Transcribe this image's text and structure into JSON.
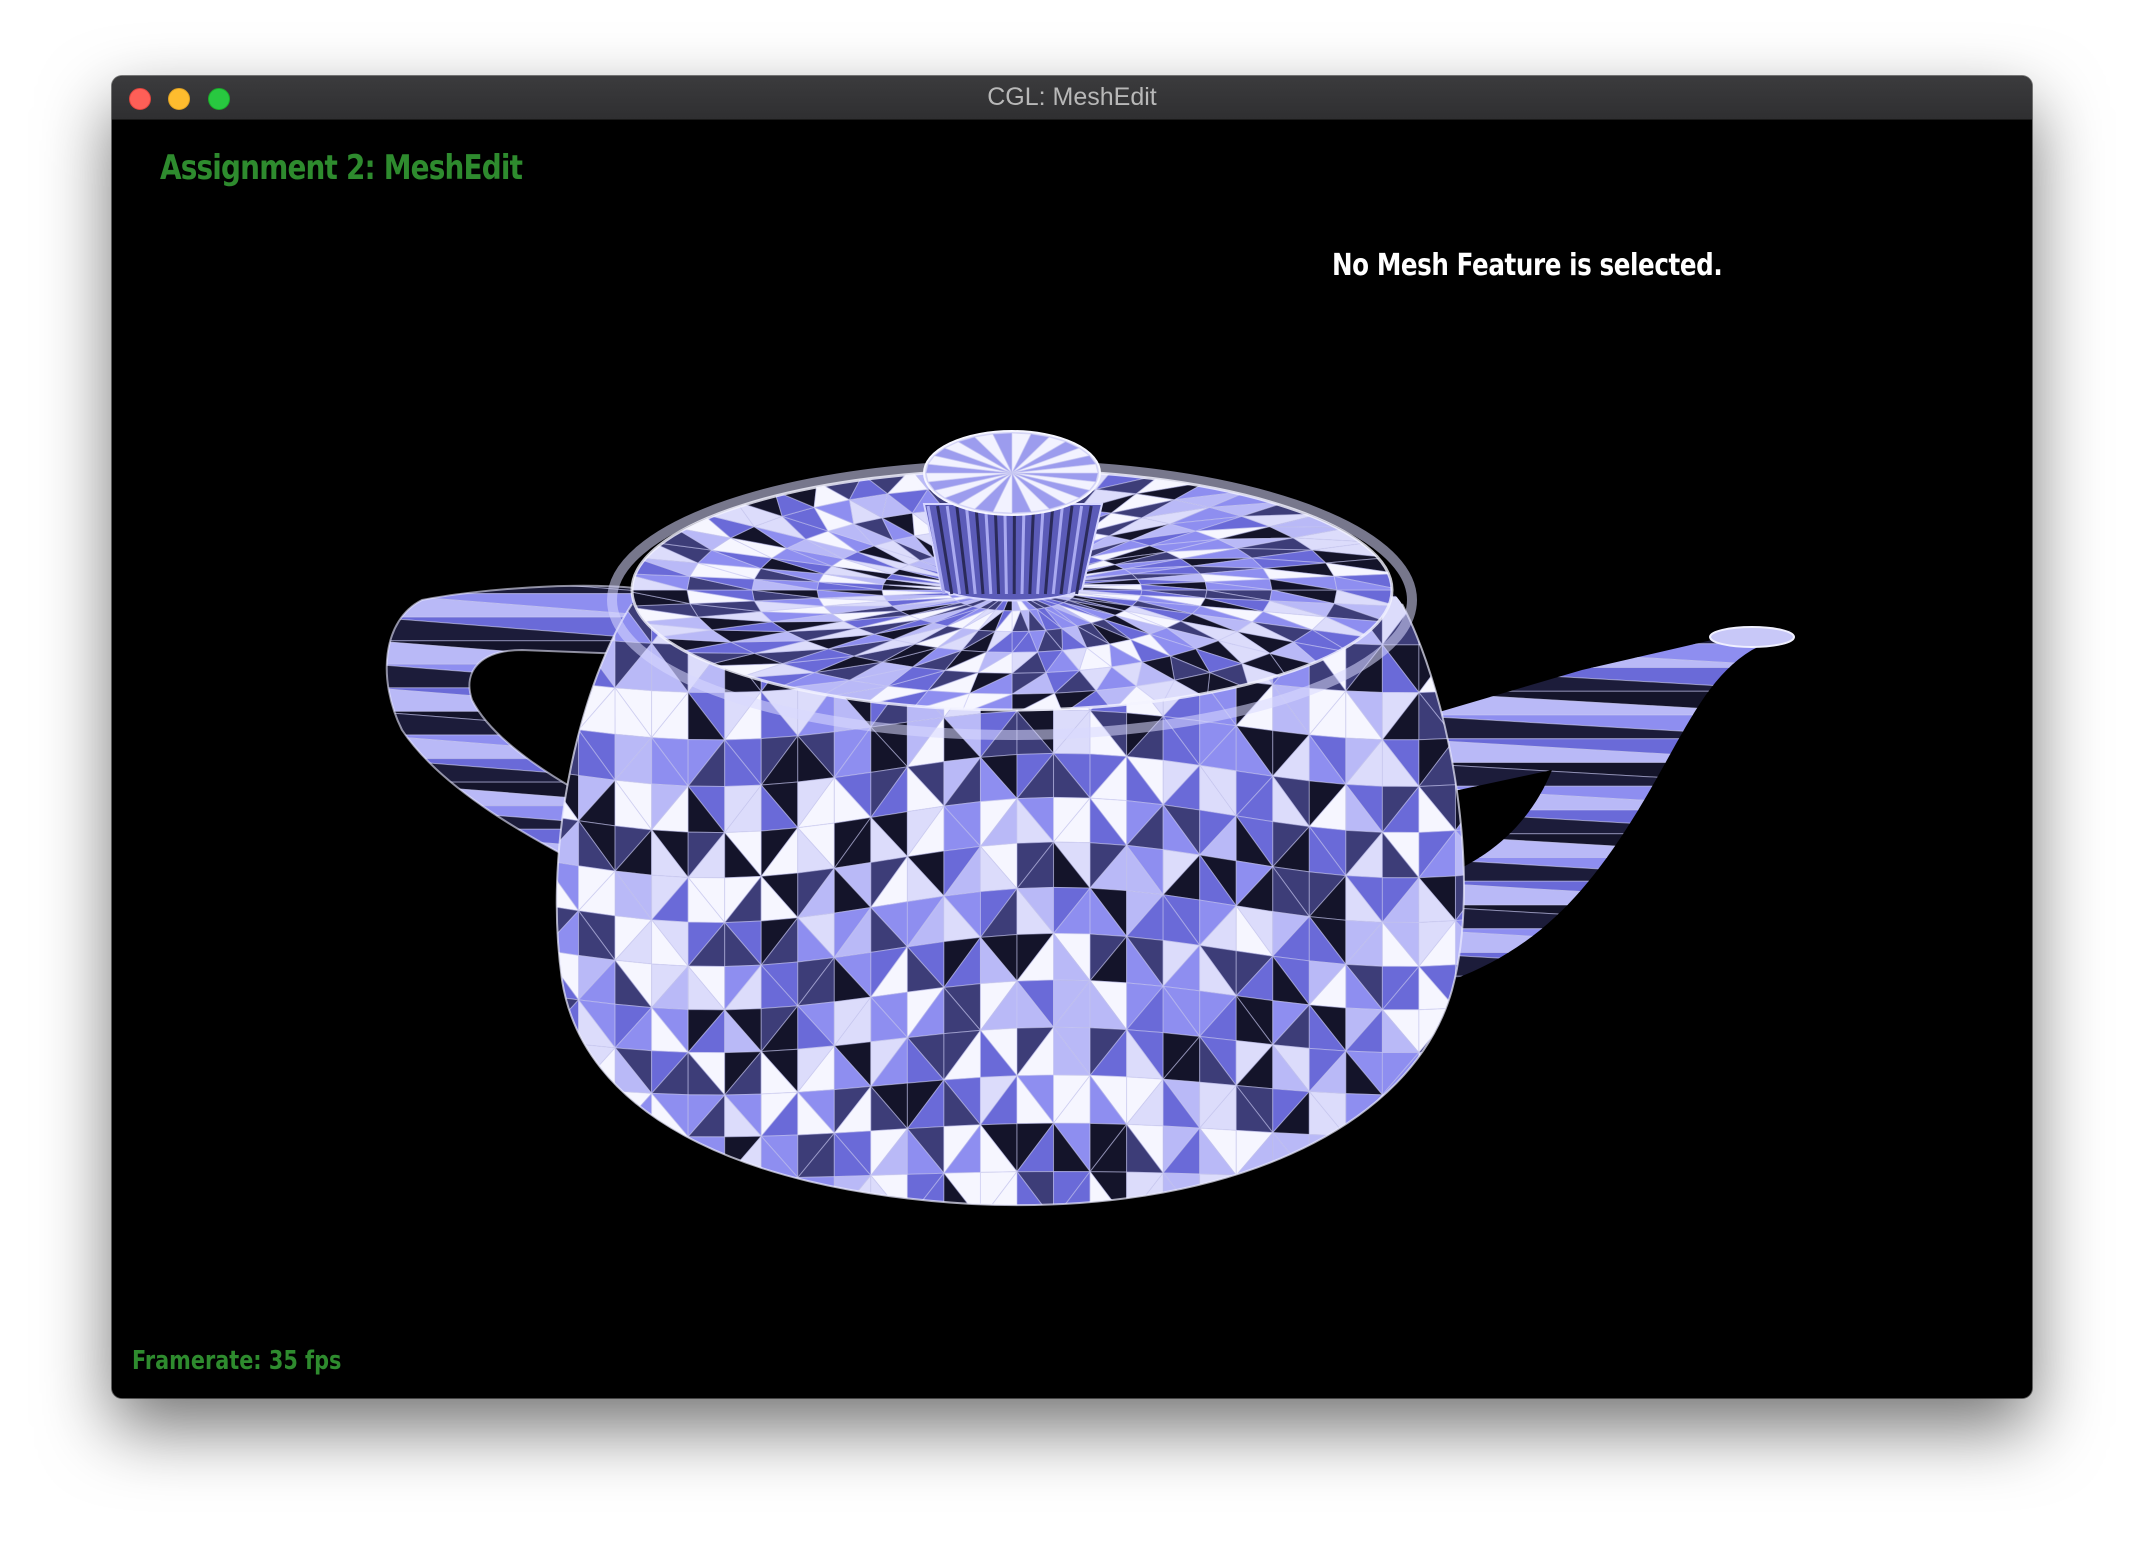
{
  "window": {
    "title": "CGL: MeshEdit"
  },
  "overlay": {
    "assignment_title": "Assignment 2: MeshEdit",
    "selection_status": "No Mesh Feature is selected.",
    "framerate": "Framerate: 35 fps"
  },
  "scene": {
    "model": "teapot",
    "background_color": "#000000",
    "mesh_colors": [
      "#f6f6ff",
      "#dcdcfb",
      "#b9b9f7",
      "#8e8ef0",
      "#6a6ad8",
      "#3d3d78",
      "#14142a"
    ],
    "label_color": "#2e8b2e"
  }
}
